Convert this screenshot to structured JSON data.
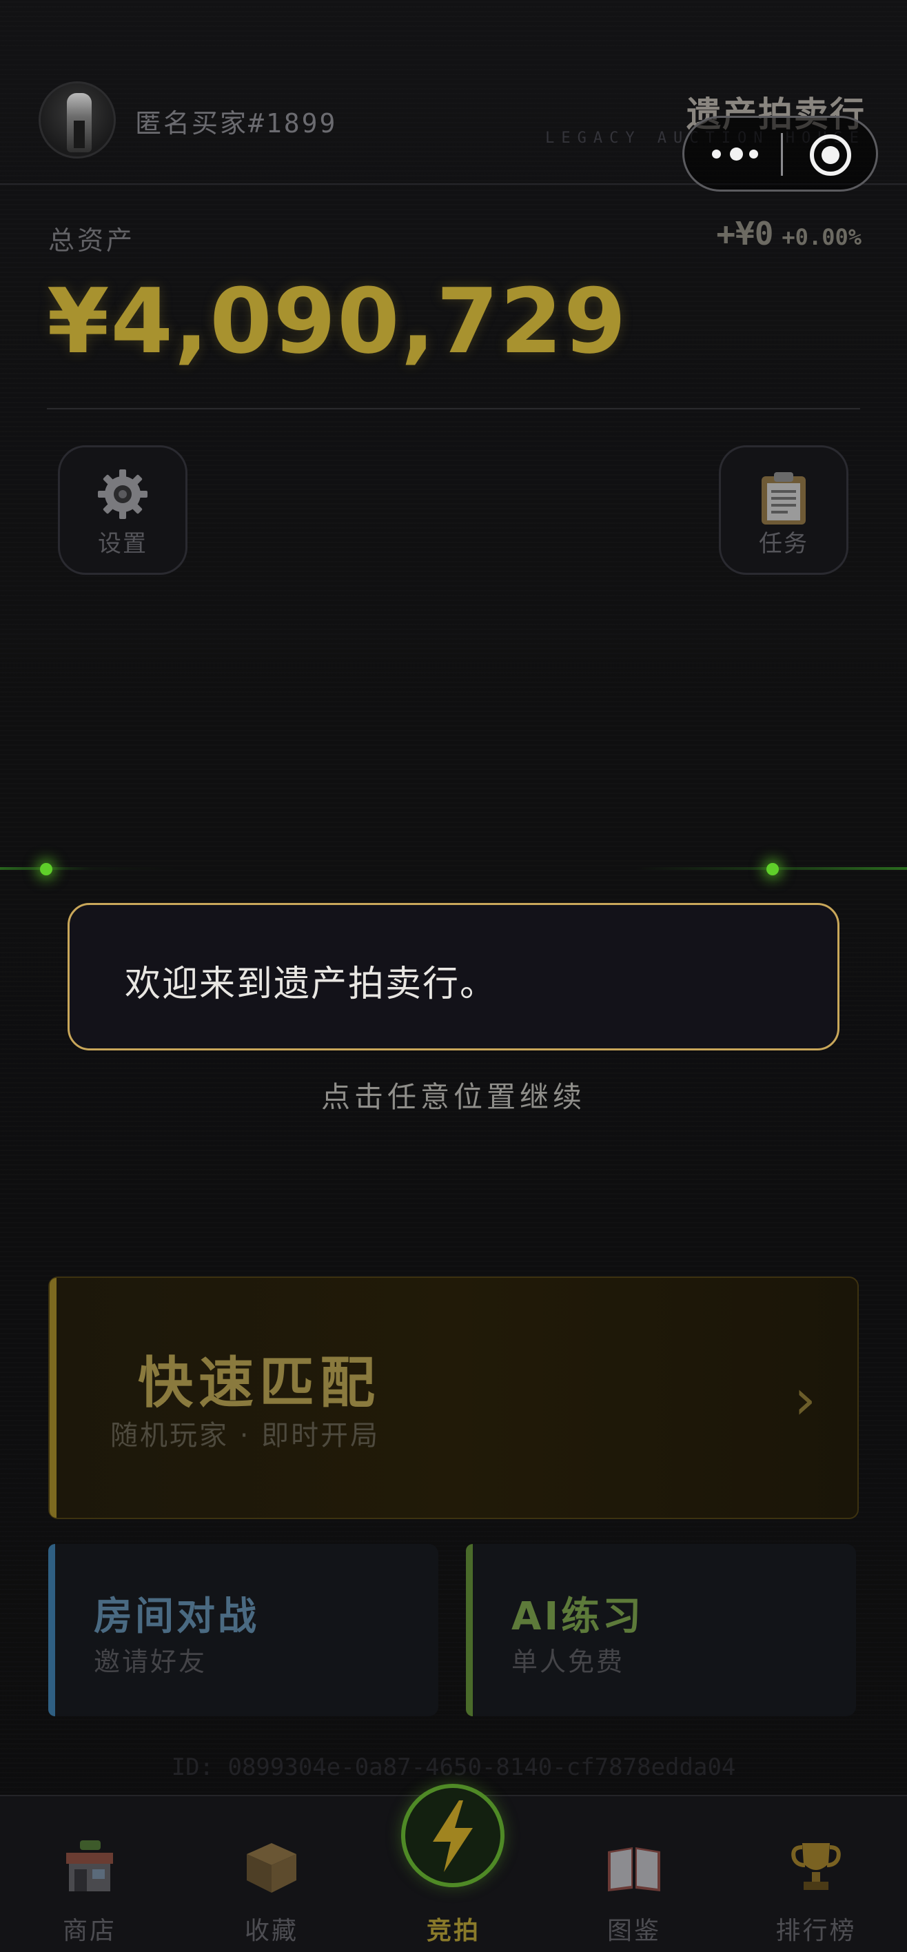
{
  "header": {
    "username": "匿名买家#1899",
    "brand_title": "遗产拍卖行",
    "brand_subtitle": "LEGACY AUCTION HOUSE"
  },
  "assets": {
    "label": "总资产",
    "value": "¥4,090,729",
    "change_amount": "+¥0",
    "change_percent": "+0.00%"
  },
  "actions": {
    "settings_label": "设置",
    "tasks_label": "任务"
  },
  "dialog": {
    "message": "欢迎来到遗产拍卖行。",
    "continue_hint": "点击任意位置继续"
  },
  "quick_match": {
    "title": "快速匹配",
    "subtitle": "随机玩家 · 即时开局",
    "arrow": "›"
  },
  "room_battle": {
    "title": "房间对战",
    "subtitle": "邀请好友"
  },
  "ai_practice": {
    "title": "AI练习",
    "subtitle": "单人免费"
  },
  "device_id": "ID: 0899304e-0a87-4650-8140-cf7878edda04",
  "nav": {
    "items": [
      {
        "label": "商店",
        "icon": "shop-icon"
      },
      {
        "label": "收藏",
        "icon": "box-icon"
      },
      {
        "label": "竞拍",
        "icon": "lightning-icon"
      },
      {
        "label": "图鉴",
        "icon": "book-icon"
      },
      {
        "label": "排行榜",
        "icon": "trophy-icon"
      }
    ],
    "active": "竞拍"
  },
  "colors": {
    "gold": "#a8922f",
    "dialog_border": "#c9a75a",
    "green_accent": "#4f8a26",
    "blue_accent": "#2f5f82",
    "ai_green": "#4a6b2a"
  }
}
